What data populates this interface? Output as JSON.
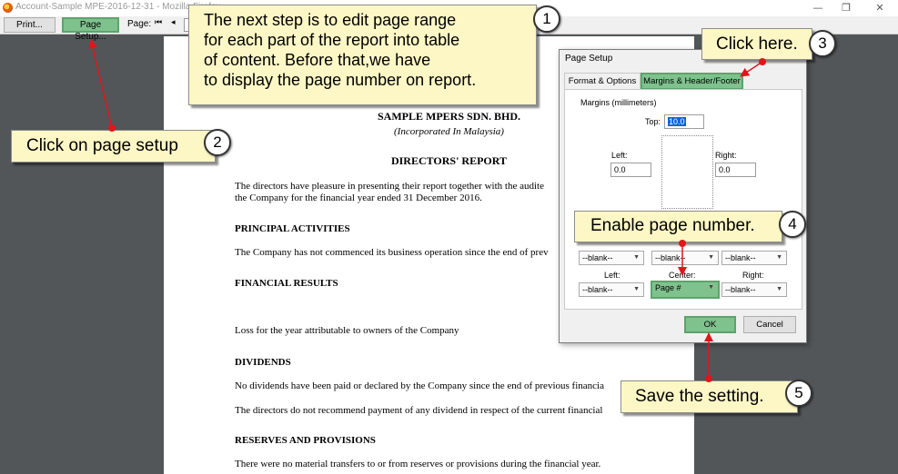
{
  "window": {
    "title": "Account-Sample MPE-2016-12-31 - Mozilla Firefox",
    "minimize": "—",
    "restore": "❐",
    "close": "✕"
  },
  "toolbar": {
    "print_label": "Print...",
    "page_setup_label": "Page Setup...",
    "page_label": "Page:",
    "first_icon": "⏮",
    "prev_icon": "◂"
  },
  "document": {
    "company": "SAMPLE MPERS SDN. BHD.",
    "incorporated": "(Incorporated In Malaysia)",
    "report_title": "DIRECTORS' REPORT",
    "intro_line1": "The directors have pleasure in presenting their report together with the audite",
    "intro_line2": "the Company for the financial year ended 31 December 2016.",
    "h_principal": "PRINCIPAL ACTIVITIES",
    "principal_text": "The Company has not commenced its business operation since the end of prev",
    "h_financial": "FINANCIAL RESULTS",
    "loss_text": "Loss for the year attributable to owners of the Company",
    "h_dividends": "DIVIDENDS",
    "dividends_text1": "No dividends have been paid or declared by the Company since the end of previous financia",
    "dividends_text2": "The directors do not recommend payment of any dividend in respect of the current financial",
    "h_reserves": "RESERVES AND PROVISIONS",
    "reserves_text": "There were no material transfers to or from reserves or provisions during the financial year."
  },
  "dialog": {
    "title": "Page Setup",
    "tabs": [
      {
        "label": "Format & Options"
      },
      {
        "label": "Margins & Header/Footer"
      }
    ],
    "margins_label": "Margins (millimeters)",
    "top_label": "Top:",
    "top_value": "10.0",
    "left_label": "Left:",
    "left_value": "0.0",
    "right_label": "Right:",
    "right_value": "0.0",
    "row1": [
      "--blank--",
      "--blank--",
      "--blank--"
    ],
    "footer_left_label": "Left:",
    "footer_center_label": "Center:",
    "footer_right_label": "Right:",
    "row2": [
      "--blank--",
      "Page #",
      "--blank--"
    ],
    "ok_label": "OK",
    "cancel_label": "Cancel"
  },
  "callouts": {
    "step1": {
      "num": "1",
      "lines": [
        "The next step is to edit page range",
        "for each part of the report into table",
        "of content. Before that,we have",
        "to display the page number on report."
      ]
    },
    "step2": {
      "num": "2",
      "text": "Click on page setup"
    },
    "step3": {
      "num": "3",
      "text": "Click here."
    },
    "step4": {
      "num": "4",
      "text": "Enable page number."
    },
    "step5": {
      "num": "5",
      "text": "Save the setting."
    }
  },
  "colors": {
    "highlight_green": "#7fc28d",
    "callout_yellow": "#fdf7c5",
    "arrow_red": "#e0161b",
    "viewer_bg": "#525659"
  }
}
